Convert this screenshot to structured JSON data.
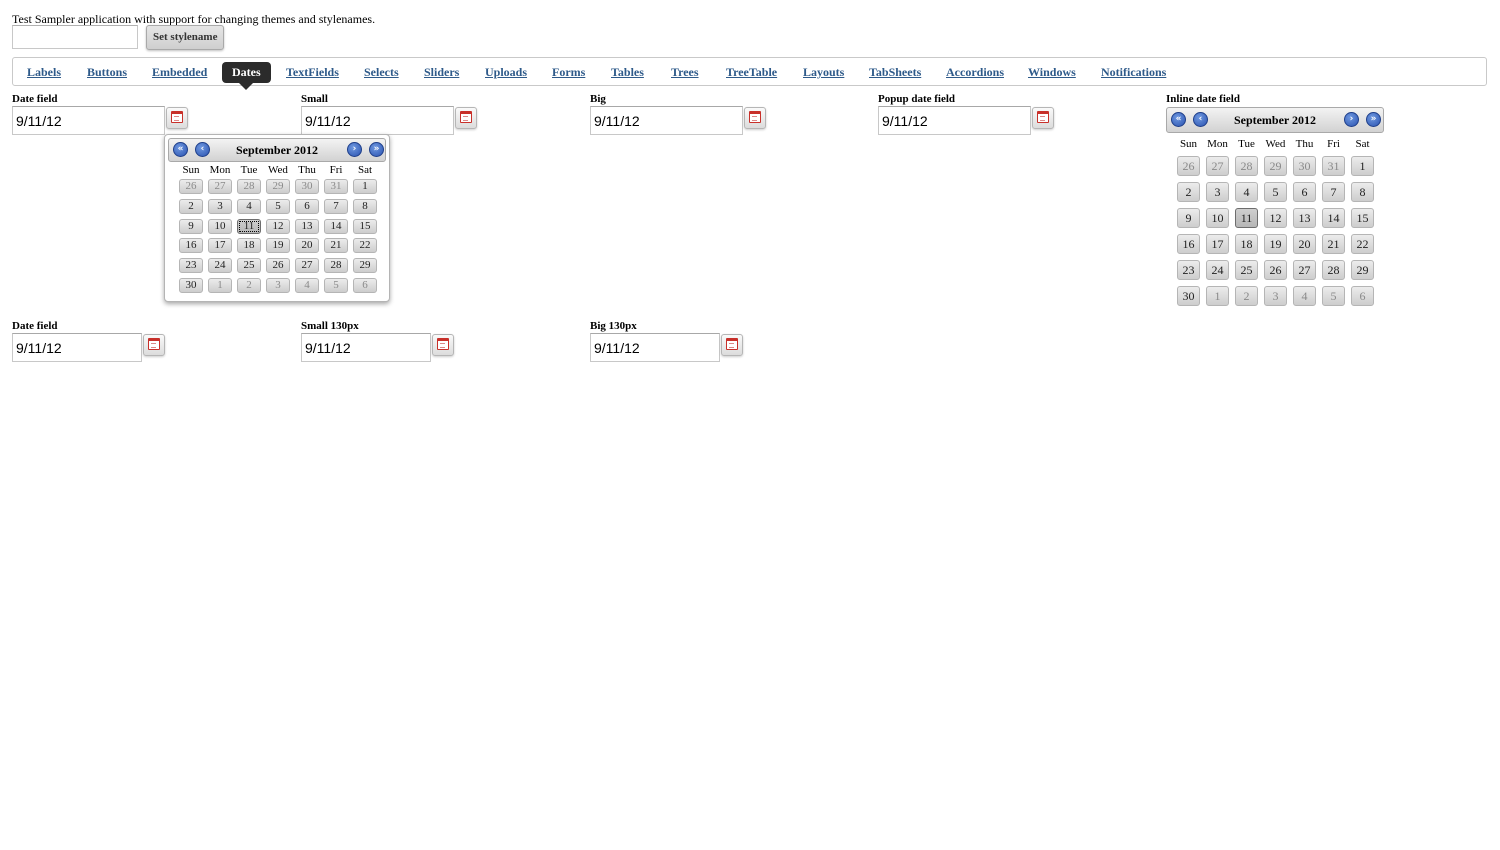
{
  "intro_text": "Test Sampler application with support for changing themes and stylenames.",
  "stylename_input": {
    "value": ""
  },
  "set_stylename_label": "Set stylename",
  "menu": [
    {
      "label": "Labels"
    },
    {
      "label": "Buttons"
    },
    {
      "label": "Embedded"
    },
    {
      "label": "Dates",
      "active": true
    },
    {
      "label": "TextFields"
    },
    {
      "label": "Selects"
    },
    {
      "label": "Sliders"
    },
    {
      "label": "Uploads"
    },
    {
      "label": "Forms"
    },
    {
      "label": "Tables"
    },
    {
      "label": "Trees"
    },
    {
      "label": "TreeTable"
    },
    {
      "label": "Layouts"
    },
    {
      "label": "TabSheets"
    },
    {
      "label": "Accordions"
    },
    {
      "label": "Windows"
    },
    {
      "label": "Notifications"
    }
  ],
  "fields": {
    "date_field": {
      "caption": "Date field",
      "value": "9/11/12"
    },
    "small": {
      "caption": "Small",
      "value": "9/11/12"
    },
    "big": {
      "caption": "Big",
      "value": "9/11/12"
    },
    "popup_date_field": {
      "caption": "Popup date field",
      "value": "9/11/12"
    },
    "inline_date_field": {
      "caption": "Inline date field"
    },
    "date_field_2": {
      "caption": "Date field",
      "value": "9/11/12"
    },
    "small_130": {
      "caption": "Small 130px",
      "value": "9/11/12"
    },
    "big_130": {
      "caption": "Big 130px",
      "value": "9/11/12"
    }
  },
  "calendar": {
    "month_label": "September 2012",
    "weekdays": [
      "Sun",
      "Mon",
      "Tue",
      "Wed",
      "Thu",
      "Fri",
      "Sat"
    ],
    "selected_day": "11",
    "weeks": [
      [
        {
          "d": "26",
          "other": true
        },
        {
          "d": "27",
          "other": true
        },
        {
          "d": "28",
          "other": true
        },
        {
          "d": "29",
          "other": true
        },
        {
          "d": "30",
          "other": true
        },
        {
          "d": "31",
          "other": true
        },
        {
          "d": "1"
        }
      ],
      [
        {
          "d": "2"
        },
        {
          "d": "3"
        },
        {
          "d": "4"
        },
        {
          "d": "5"
        },
        {
          "d": "6"
        },
        {
          "d": "7"
        },
        {
          "d": "8"
        }
      ],
      [
        {
          "d": "9"
        },
        {
          "d": "10"
        },
        {
          "d": "11"
        },
        {
          "d": "12"
        },
        {
          "d": "13"
        },
        {
          "d": "14"
        },
        {
          "d": "15"
        }
      ],
      [
        {
          "d": "16"
        },
        {
          "d": "17"
        },
        {
          "d": "18"
        },
        {
          "d": "19"
        },
        {
          "d": "20"
        },
        {
          "d": "21"
        },
        {
          "d": "22"
        }
      ],
      [
        {
          "d": "23"
        },
        {
          "d": "24"
        },
        {
          "d": "25"
        },
        {
          "d": "26"
        },
        {
          "d": "27"
        },
        {
          "d": "28"
        },
        {
          "d": "29"
        }
      ],
      [
        {
          "d": "30"
        },
        {
          "d": "1",
          "other": true
        },
        {
          "d": "2",
          "other": true
        },
        {
          "d": "3",
          "other": true
        },
        {
          "d": "4",
          "other": true
        },
        {
          "d": "5",
          "other": true
        },
        {
          "d": "6",
          "other": true
        }
      ]
    ]
  },
  "icons": {
    "calendar": "calendar-icon",
    "prev_year": "prev-year-icon",
    "prev_month": "prev-month-icon",
    "next_month": "next-month-icon",
    "next_year": "next-year-icon"
  },
  "colors": {
    "link": "#2e5a8a",
    "active_tab": "#2b2b2b",
    "nav_button": "#2a53b0",
    "calendar_icon": "#c8302a"
  }
}
